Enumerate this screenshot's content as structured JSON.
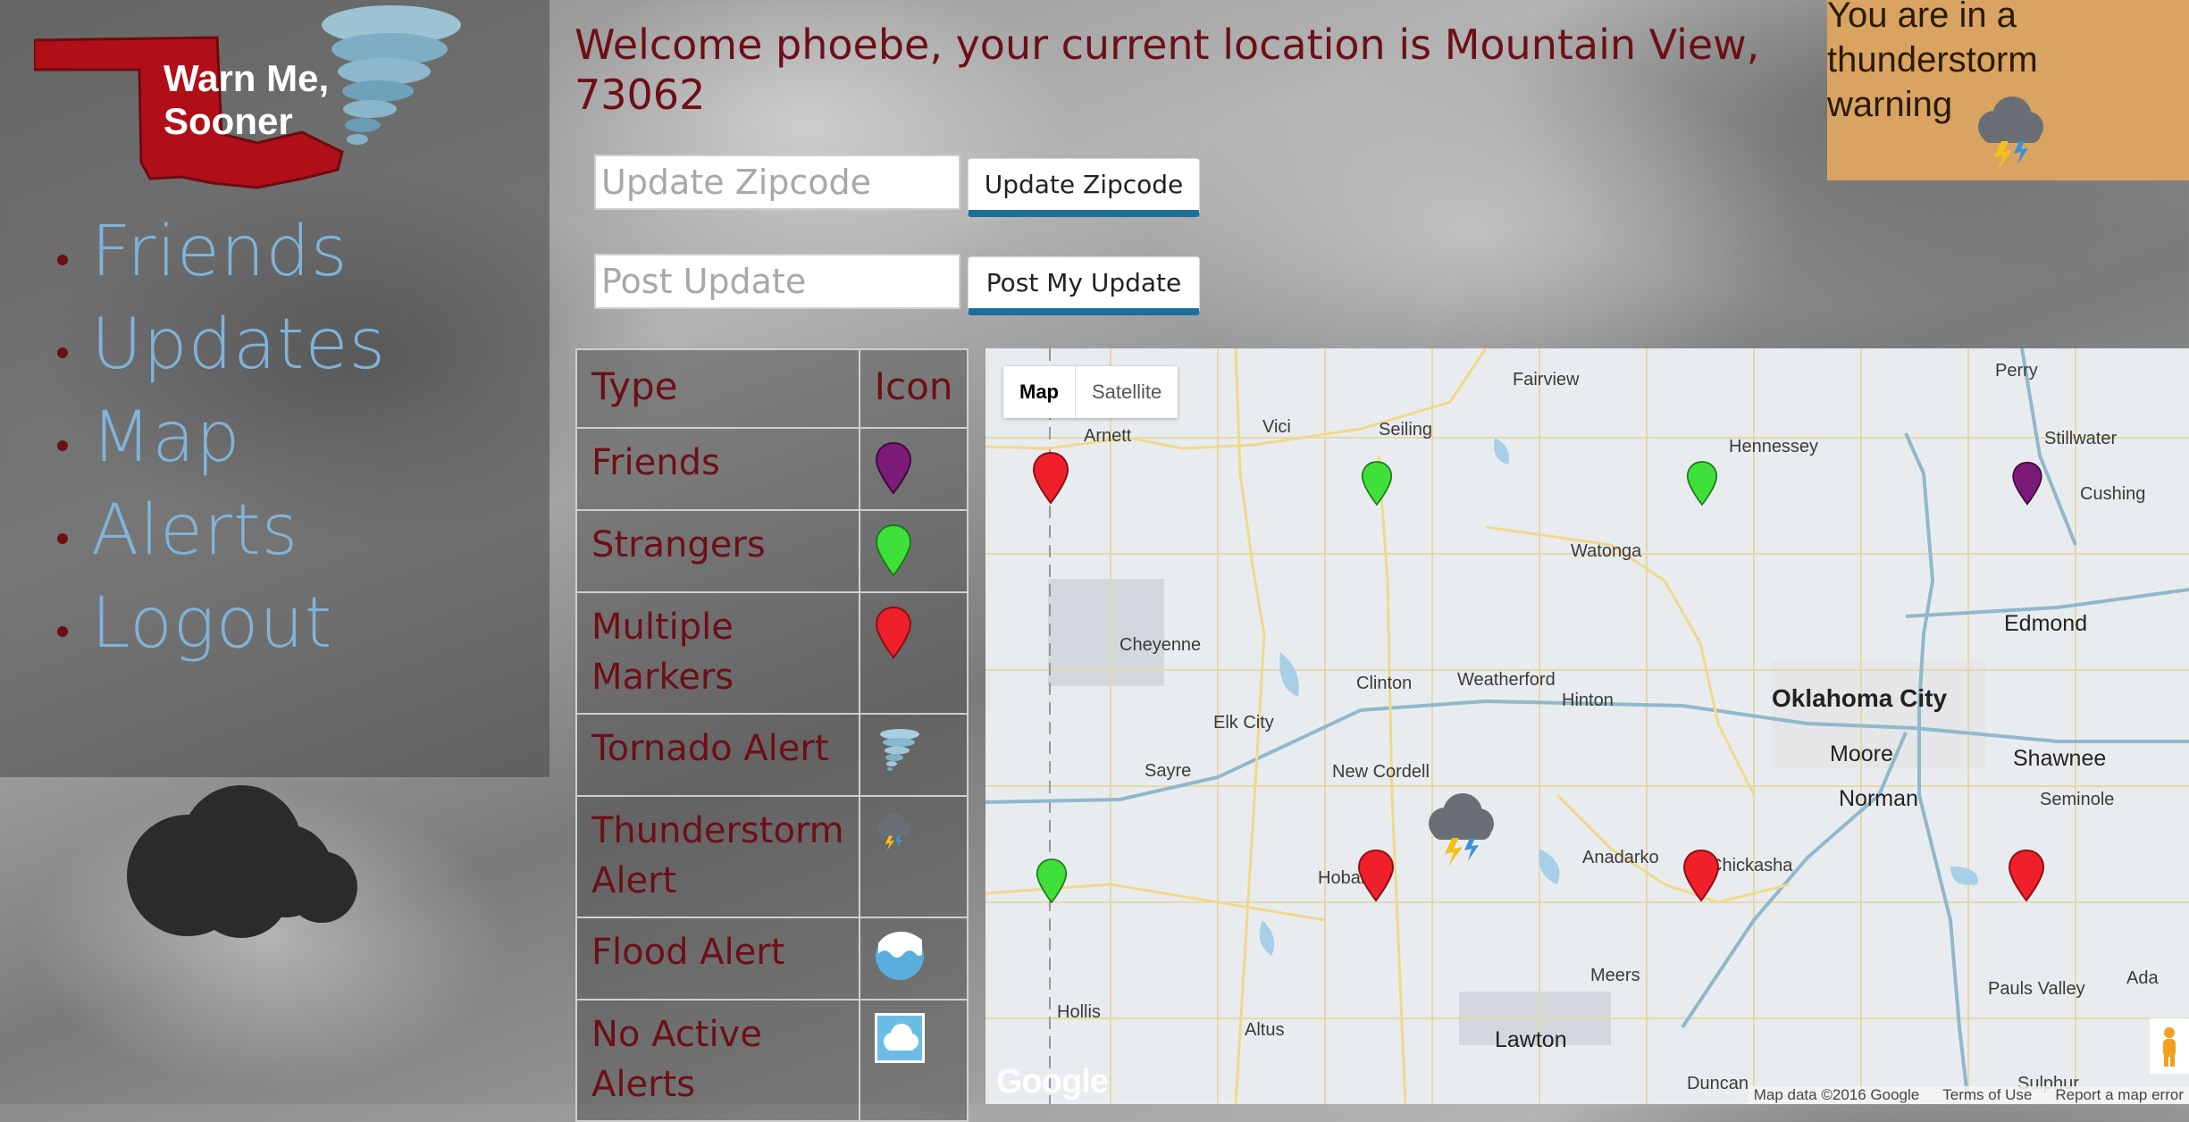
{
  "app": {
    "logo_text_line1": "Warn Me,",
    "logo_text_line2": "Sooner"
  },
  "nav": {
    "items": [
      "Friends",
      "Updates",
      "Map",
      "Alerts",
      "Logout"
    ]
  },
  "welcome": "Welcome phoebe, your current location is Mountain View, 73062",
  "zip_form": {
    "placeholder": "Update Zipcode",
    "button": "Update Zipcode"
  },
  "post_form": {
    "placeholder": "Post Update",
    "button": "Post My Update"
  },
  "alert_box": {
    "text": "You are in a thunderstorm warning",
    "icon": "thunderstorm-icon"
  },
  "legend": {
    "headers": [
      "Type",
      "Icon"
    ],
    "rows": [
      {
        "type": "Friends",
        "icon": "purple-marker-icon",
        "color": "#7b1a78"
      },
      {
        "type": "Strangers",
        "icon": "green-marker-icon",
        "color": "#3fe03a"
      },
      {
        "type": "Multiple Markers",
        "icon": "red-marker-icon",
        "color": "#f0202a"
      },
      {
        "type": "Tornado Alert",
        "icon": "tornado-icon"
      },
      {
        "type": "Thunderstorm Alert",
        "icon": "thunderstorm-icon"
      },
      {
        "type": "Flood Alert",
        "icon": "flood-icon"
      },
      {
        "type": "No Active Alerts",
        "icon": "cloud-icon"
      }
    ]
  },
  "map": {
    "type_buttons": [
      "Map",
      "Satellite"
    ],
    "cities": [
      "Arnett",
      "Vici",
      "Seiling",
      "Fairview",
      "Hennessey",
      "Perry",
      "Stillwater",
      "Cushing",
      "Watonga",
      "Edmond",
      "Cheyenne",
      "Clinton",
      "Weatherford",
      "Hinton",
      "Oklahoma City",
      "Elk City",
      "Sayre",
      "New Cordell",
      "Moore",
      "Shawnee",
      "Norman",
      "Seminole",
      "Anadarko",
      "Chickasha",
      "Hobart",
      "Meers",
      "Pauls Valley",
      "Ada",
      "Hollis",
      "Altus",
      "Lawton",
      "Duncan",
      "Sulphur"
    ],
    "attribution": [
      "Map data ©2016 Google",
      "Terms of Use",
      "Report a map error"
    ],
    "logo": "Google"
  },
  "colors": {
    "accent_red": "#6d0f17",
    "link_blue": "#7fb3d9",
    "button_underline": "#1f6e9a",
    "alert_bg": "#d9a461"
  }
}
